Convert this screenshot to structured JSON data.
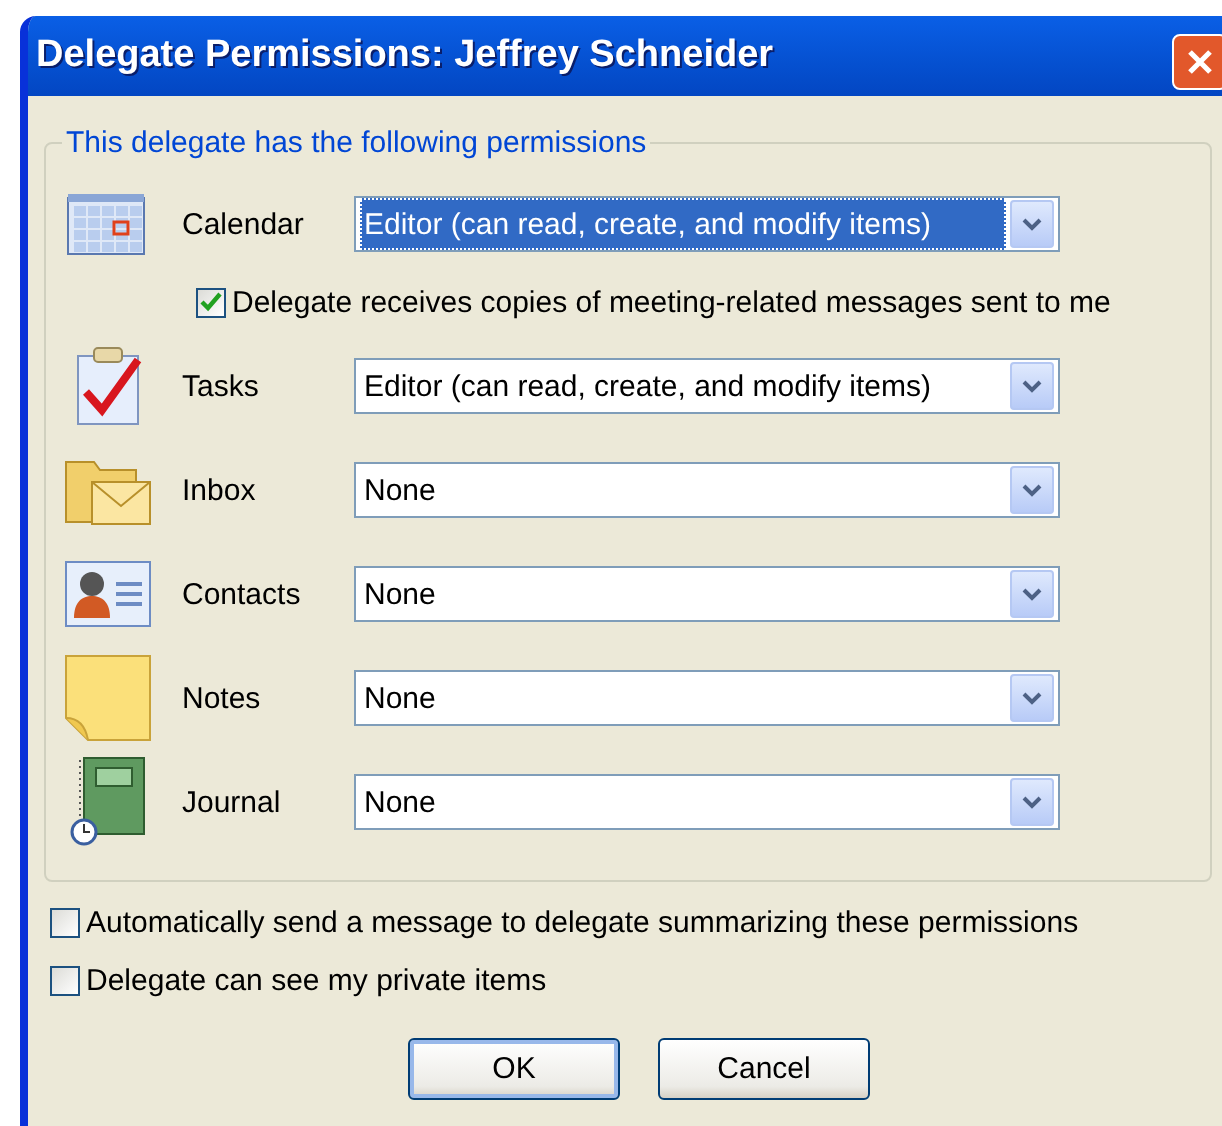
{
  "window": {
    "title": "Delegate Permissions: Jeffrey Schneider"
  },
  "group": {
    "legend": "This delegate has the following permissions"
  },
  "permissions": [
    {
      "kind": "calendar",
      "label": "Calendar",
      "value": "Editor (can read, create, and modify items)",
      "focused": true,
      "option": {
        "label": "Delegate receives copies of meeting-related messages sent to me",
        "checked": true
      }
    },
    {
      "kind": "tasks",
      "label": "Tasks",
      "value": "Editor (can read, create, and modify items)",
      "focused": false
    },
    {
      "kind": "inbox",
      "label": "Inbox",
      "value": "None",
      "focused": false
    },
    {
      "kind": "contacts",
      "label": "Contacts",
      "value": "None",
      "focused": false
    },
    {
      "kind": "notes",
      "label": "Notes",
      "value": "None",
      "focused": false
    },
    {
      "kind": "journal",
      "label": "Journal",
      "value": "None",
      "focused": false
    }
  ],
  "options": [
    {
      "label": "Automatically send a message to delegate summarizing these permissions",
      "checked": false
    },
    {
      "label": "Delegate can see my private items",
      "checked": false
    }
  ],
  "buttons": [
    {
      "label": "OK",
      "default": true
    },
    {
      "label": "Cancel",
      "default": false
    }
  ]
}
